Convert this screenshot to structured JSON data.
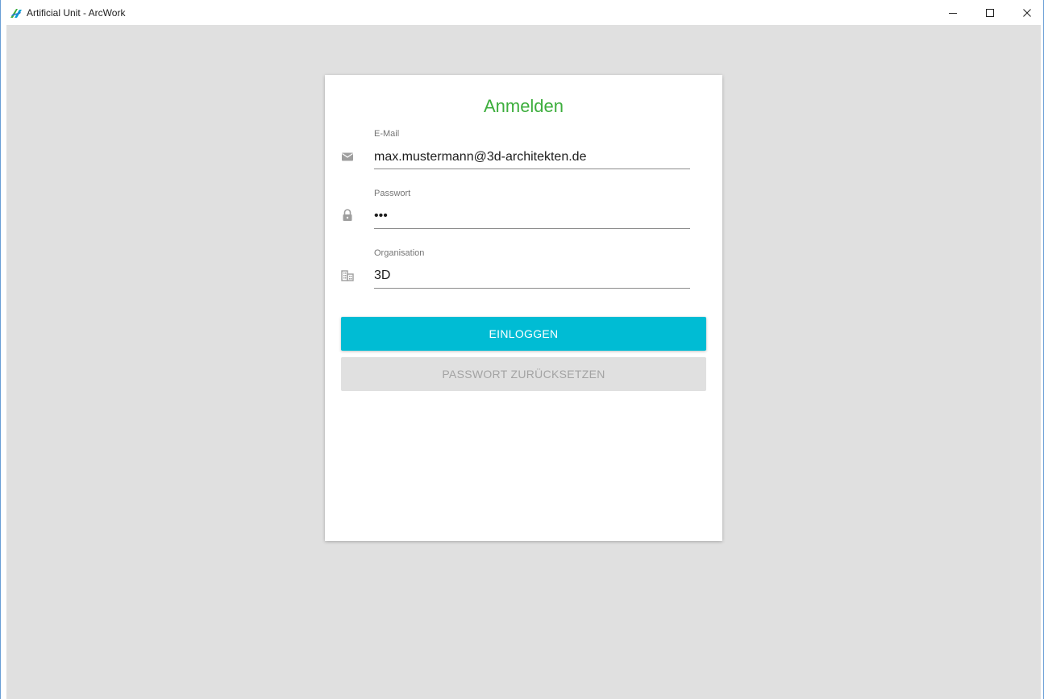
{
  "window": {
    "title": "Artificial Unit - ArcWork"
  },
  "login": {
    "title": "Anmelden",
    "email": {
      "label": "E-Mail",
      "value": "max.mustermann@3d-architekten.de"
    },
    "password": {
      "label": "Passwort",
      "value": "•••"
    },
    "organisation": {
      "label": "Organisation",
      "value": "3D"
    },
    "login_button": "EINLOGGEN",
    "reset_button": "PASSWORT ZURÜCKSETZEN"
  },
  "colors": {
    "accent": "#00bcd4",
    "title_green": "#3dae3d",
    "background": "#e0e0e0"
  },
  "icons": {
    "app": "arcwork-logo-icon",
    "email": "mail-icon",
    "password": "lock-icon",
    "organisation": "building-icon"
  }
}
